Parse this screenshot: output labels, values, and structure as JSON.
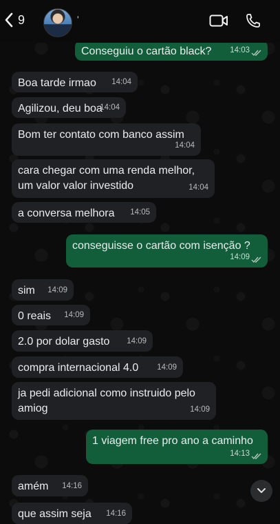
{
  "header": {
    "back_count": "9",
    "contact_name": "'"
  },
  "messages": [
    {
      "id": "m1",
      "dir": "out",
      "text": "Conseguiu o cartão black?",
      "time": "14:03",
      "read": true
    },
    {
      "id": "m2",
      "dir": "in",
      "text": "Boa tarde irmao",
      "time": "14:04"
    },
    {
      "id": "m3",
      "dir": "in",
      "text": "Agilizou, deu boa",
      "time": "14:04"
    },
    {
      "id": "m4",
      "dir": "in",
      "text": "Bom ter contato com banco assim",
      "time": "14:04"
    },
    {
      "id": "m5",
      "dir": "in",
      "text_lines": [
        "cara chegar com uma renda melhor,",
        "um valor valor investido"
      ],
      "time": "14:04"
    },
    {
      "id": "m6",
      "dir": "in",
      "text": "a conversa melhora",
      "time": "14:05"
    },
    {
      "id": "m7",
      "dir": "out",
      "text": "conseguisse o cartão com isenção ?",
      "time": "14:09",
      "read": true
    },
    {
      "id": "m8",
      "dir": "in",
      "text": "sim",
      "time": "14:09"
    },
    {
      "id": "m9",
      "dir": "in",
      "text": "0 reais",
      "time": "14:09"
    },
    {
      "id": "m10",
      "dir": "in",
      "text": "2.0 por dolar gasto",
      "time": "14:09"
    },
    {
      "id": "m11",
      "dir": "in",
      "text": "compra internacional 4.0",
      "time": "14:09"
    },
    {
      "id": "m12",
      "dir": "in",
      "text_lines": [
        "ja pedi adicional como instruido pelo",
        "amiog"
      ],
      "time": "14:09"
    },
    {
      "id": "m13",
      "dir": "out",
      "text": "1 viagem free pro ano a caminho",
      "time": "14:13",
      "read": true
    },
    {
      "id": "m14",
      "dir": "in",
      "text": "amém",
      "time": "14:16"
    },
    {
      "id": "m15",
      "dir": "in",
      "text": "que assim seja",
      "time": "14:16"
    }
  ],
  "colors": {
    "incoming_bubble": "#202124",
    "outgoing_bubble": "#125e3a",
    "read_check": "#53bdeb"
  },
  "icons": [
    "chevron-left-icon",
    "video-camera-icon",
    "phone-icon",
    "double-check-icon",
    "chevron-down-icon"
  ]
}
